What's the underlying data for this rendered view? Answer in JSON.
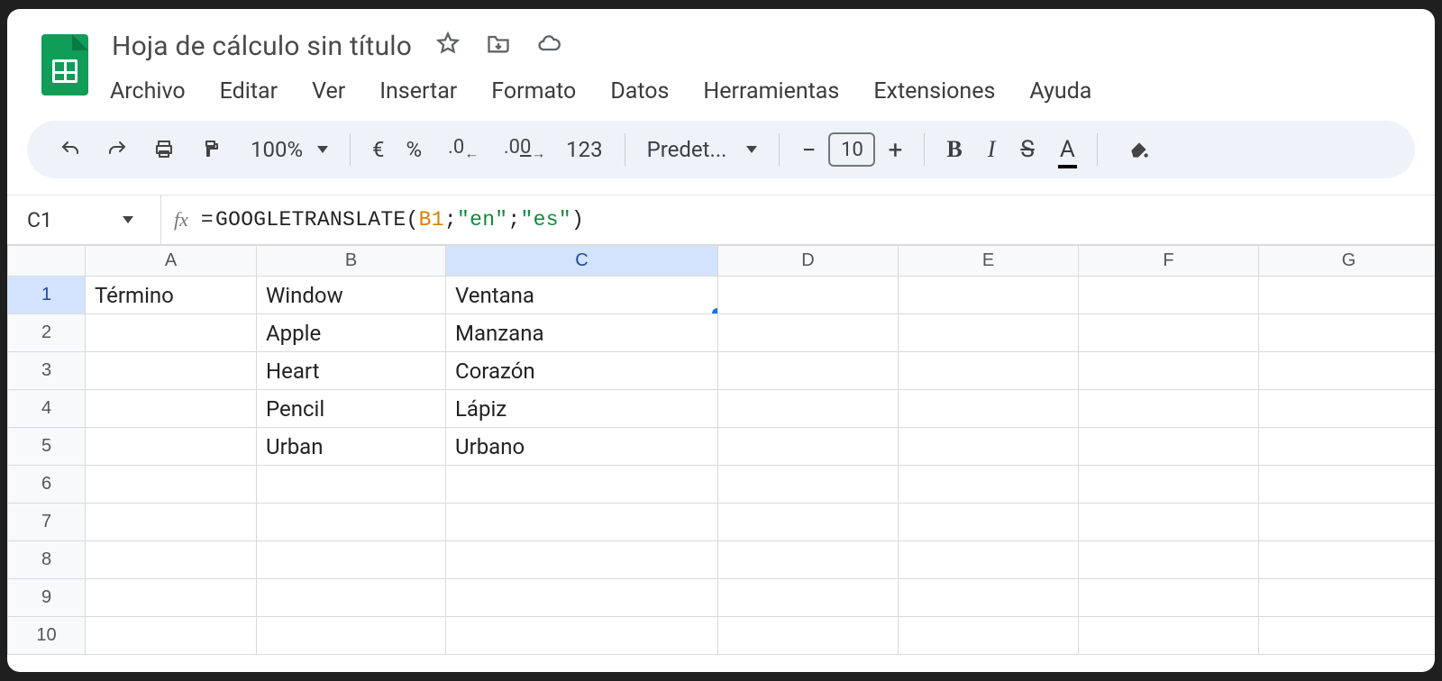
{
  "doc": {
    "title": "Hoja de cálculo sin título"
  },
  "menu": {
    "archivo": "Archivo",
    "editar": "Editar",
    "ver": "Ver",
    "insertar": "Insertar",
    "formato": "Formato",
    "datos": "Datos",
    "herramientas": "Herramientas",
    "extensiones": "Extensiones",
    "ayuda": "Ayuda"
  },
  "toolbar": {
    "zoom": "100%",
    "currency": "€",
    "percent": "%",
    "dec_less": ".0",
    "dec_more": ".00",
    "numfmt": "123",
    "font": "Predet...",
    "font_size": "10",
    "bold": "B",
    "italic": "I",
    "strike": "S",
    "textcolor": "A"
  },
  "fx": {
    "cell_ref": "C1",
    "fn_name": "GOOGLETRANSLATE",
    "arg_ref": "B1",
    "arg_str1": "\"en\"",
    "arg_str2": "\"es\""
  },
  "columns": [
    "A",
    "B",
    "C",
    "D",
    "E",
    "F",
    "G"
  ],
  "row_labels": [
    "1",
    "2",
    "3",
    "4",
    "5",
    "6",
    "7",
    "8",
    "9",
    "10"
  ],
  "cells": {
    "A1": "Término",
    "B1": "Window",
    "C1": "Ventana",
    "B2": "Apple",
    "C2": "Manzana",
    "B3": "Heart",
    "C3": "Corazón",
    "B4": "Pencil",
    "C4": "Lápiz",
    "B5": "Urban",
    "C5": "Urbano"
  },
  "selection": {
    "col": "C",
    "row": "1"
  }
}
